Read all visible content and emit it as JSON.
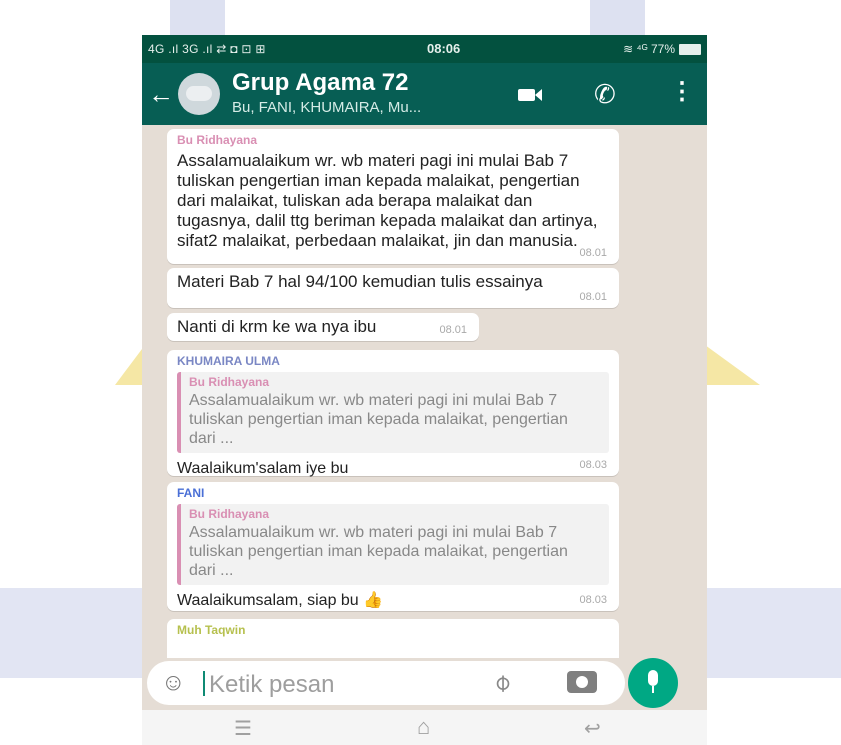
{
  "status_bar": {
    "signal": "4G .ıl 3G .ıl ⇄ ◘ ⊡ ⊞",
    "time": "08:06",
    "battery": "≋ ⁴ᴳ 77%"
  },
  "header": {
    "title": "Grup Agama 72",
    "subtitle": "Bu, FANI, KHUMAIRA, Mu..."
  },
  "colors": {
    "status_bar": "#03513f",
    "app_bar": "#075e54",
    "chat_bg": "#e5ddd5",
    "accent": "#00a884"
  },
  "messages": [
    {
      "sender": "Bu Ridhayana",
      "sender_color": "#d98fb3",
      "text": "Assalamualaikum wr. wb materi pagi ini mulai Bab 7 tuliskan pengertian iman kepada malaikat, pengertian dari malaikat, tuliskan ada berapa malaikat dan tugasnya, dalil ttg beriman kepada malaikat dan artinya, sifat2 malaikat, perbedaan malaikat, jin dan manusia.",
      "time": "08.01"
    },
    {
      "text": "Materi Bab 7 hal 94/100 kemudian tulis essainya",
      "time": "08.01"
    },
    {
      "text": "Nanti di krm ke wa nya ibu",
      "time": "08.01"
    },
    {
      "sender": "KHUMAIRA ULMA",
      "sender_color": "#7a87c4",
      "quote_sender": "Bu Ridhayana",
      "quote_text": "Assalamualaikum wr. wb materi pagi ini mulai Bab 7 tuliskan pengertian iman kepada malaikat, pengertian dari ...",
      "text": "Waalaikum'salam iye bu",
      "time": "08.03"
    },
    {
      "sender": "FANI",
      "sender_color": "#4a6fd6",
      "quote_sender": "Bu Ridhayana",
      "quote_text": "Assalamualaikum wr. wb materi pagi ini mulai Bab 7 tuliskan pengertian iman kepada malaikat, pengertian dari ...",
      "text": "Waalaikumsalam, siap bu 👍",
      "time": "08.03"
    },
    {
      "sender": "Muh Taqwin",
      "sender_color": "#b6c04e"
    }
  ],
  "input": {
    "placeholder": "Ketik pesan"
  },
  "icons": [
    "back-arrow-icon",
    "group-avatar-icon",
    "video-call-icon",
    "phone-icon",
    "more-icon",
    "emoji-icon",
    "attach-icon",
    "camera-icon",
    "mic-icon",
    "nav-menu-icon",
    "nav-home-icon",
    "nav-back-icon"
  ]
}
